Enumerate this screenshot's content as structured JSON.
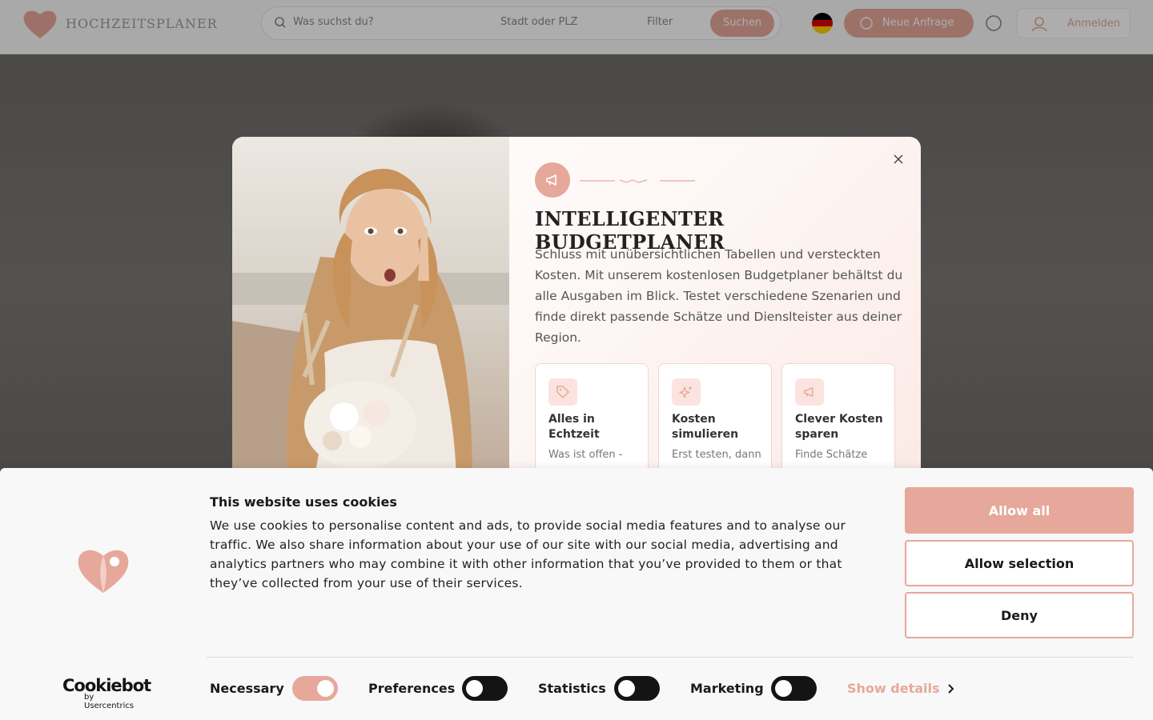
{
  "background": {
    "logo_text": "HOCHZEITSPLANER",
    "search_placeholder": "Was suchst du?",
    "city_placeholder": "Stadt oder PLZ",
    "filter_label": "Filter",
    "search_button": "Suchen",
    "budget_button": "Neue Anfrage",
    "login_button": "Anmelden",
    "flag": "de"
  },
  "modal": {
    "title": "INTELLIGENTER BUDGETPLANER",
    "description": "Schluss mit unübersichtlichen Tabellen und versteckten Kosten. Mit unserem kostenlosen Budgetplaner behältst du alle Ausgaben im Blick. Testet verschiedene Szenarien und finde direkt passende Schätze und Dienslteister aus deiner Region.",
    "features": [
      {
        "icon": "tag-icon",
        "title": "Alles in Echtzeit",
        "text": "Was ist offen -"
      },
      {
        "icon": "sparkle-icon",
        "title": "Kosten simulieren",
        "text": "Erst testen, dann"
      },
      {
        "icon": "megaphone-icon",
        "title": "Clever Kosten sparen",
        "text": "Finde Schätze"
      }
    ]
  },
  "cookie": {
    "title": "This website uses cookies",
    "text": "We use cookies to personalise content and ads, to provide social media features and to analyse our traffic. We also share information about your use of our site with our social media, advertising and analytics partners who may combine it with other information that you’ve provided to them or that they’ve collected from your use of their services.",
    "allow_all": "Allow all",
    "allow_selection": "Allow selection",
    "deny": "Deny",
    "brand_name": "Cookiebot",
    "brand_sub": "by Usercentrics",
    "toggles": [
      {
        "label": "Necessary",
        "state": "on"
      },
      {
        "label": "Preferences",
        "state": "off"
      },
      {
        "label": "Statistics",
        "state": "off"
      },
      {
        "label": "Marketing",
        "state": "off"
      }
    ],
    "show_details": "Show details"
  },
  "colors": {
    "accent": "#e6a89a",
    "dark": "#141414",
    "banner_bg": "#f8f8f8"
  }
}
